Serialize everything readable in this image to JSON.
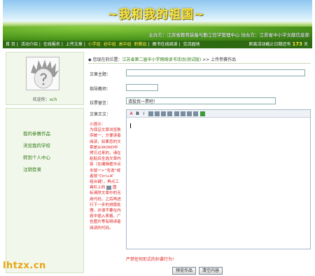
{
  "banner": {
    "title": "~我和我的祖国~",
    "organizer": "主办方：江苏省教育装备与勤工俭学管理中心 协办方：江苏省中小学文献信息部"
  },
  "nav": {
    "items": [
      "首 页",
      "活动介绍",
      "在线报名",
      "上传文章"
    ],
    "highlighted": [
      "小学组",
      "初中组",
      "高中组",
      "职教组"
    ],
    "tail": [
      "图书在线阅读",
      "交流园地"
    ],
    "countdown_label": "距离活动截止日期还有",
    "days": "173",
    "days_unit": "天"
  },
  "sidebar": {
    "welcome_prefix": "欢迎你：",
    "username": "xch",
    "menu": [
      "我的参赛作品",
      "浏览我的学校",
      "转到个人中心",
      "注销登录"
    ]
  },
  "breadcrumb": {
    "prefix": "◆ 您现在的位置：",
    "link": "江苏省第二届中小学网络读书活动(测试版)",
    "sep": " >> ",
    "current": "上传参赛作品"
  },
  "form": {
    "title_label": "文章主题：",
    "title_value": "",
    "teacher_label": "指导教师：",
    "teacher_value": "",
    "message_label": "拉票留言：",
    "message_value": "请投我一票吧！",
    "body_label": "文章正文："
  },
  "toolbar": {
    "buttons": [
      "A",
      "B",
      "I"
    ]
  },
  "tips": {
    "title": "小提示：",
    "lines": [
      "为保证文章浏览秩",
      "序统一，方便读者",
      "阅读，如果您的文",
      "章是从WORD中",
      "拷贝过来的，请在",
      "粘贴后全选文章内",
      "容（在编辑框中点",
      "击鼠一>“全选”或",
      "者按“Ctrl+A”",
      "组合键），再点工",
      "具栏上的",
      "标清除文章中的无",
      "用代码，之后再进",
      "行下一步的排版处",
      "理。并请不要在内",
      "容中插入表格、广",
      "告图片等有碍读者",
      "阅读的代码。"
    ],
    "icon_suffix": "图"
  },
  "warning": "严禁任何形式的抄袭行为!",
  "buttons": {
    "preview": "预览作品",
    "clear": "清空内容"
  },
  "watermark": "lhtzx.cn",
  "colors": {
    "nav_bg": "#2d6a12",
    "accent_green": "#2d7a12",
    "warning_red": "#e02020",
    "title_yellow": "#f6e44a"
  }
}
